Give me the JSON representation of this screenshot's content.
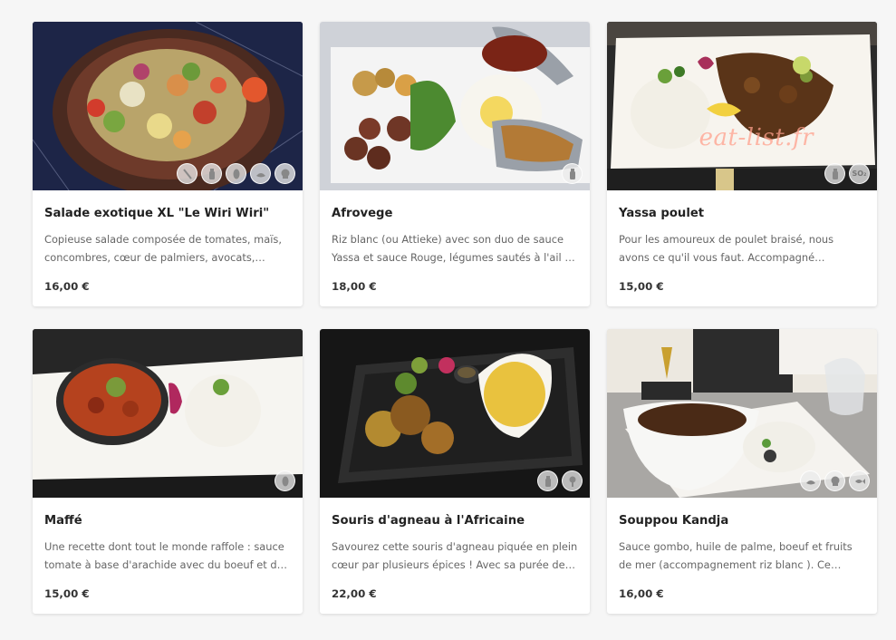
{
  "watermark": "eat-list.fr",
  "dishes": [
    {
      "title": "Salade exotique XL \"Le Wiri Wiri\"",
      "description": "Copieuse salade composée de tomates, maïs, concombres, cœur de palmiers, avocats, crevettes et oignons rouges.",
      "price": "16,00 €",
      "badge_icons": [
        "cutlery-icon",
        "bottle-icon",
        "peanut-icon",
        "shellfish-icon",
        "chef-hat-icon"
      ]
    },
    {
      "title": "Afrovege",
      "description": "Riz blanc (ou Attieke) avec son duo de sauce Yassa et sauce Rouge, légumes sautés à l'ail et bananes plantain.",
      "price": "18,00 €",
      "badge_icons": [
        "bottle-icon"
      ]
    },
    {
      "title": "Yassa poulet",
      "description": "Pour les amoureux de poulet braisé, nous avons ce qu'il vous faut. Accompagné d'oignons confits et de riz.",
      "price": "15,00 €",
      "badge_icons": [
        "bottle-icon",
        "so2-icon"
      ],
      "badge_text": "SO₂"
    },
    {
      "title": "Maffé",
      "description": "Une recette dont tout le monde raffole : sauce tomate à base d'arachide avec du boeuf et des légumes.",
      "price": "15,00 €",
      "badge_icons": [
        "peanut-icon"
      ]
    },
    {
      "title": "Souris d'agneau à l'Africaine",
      "description": "Savourez cette souris d'agneau piquée en plein cœur par plusieurs épices ! Avec sa purée de patates douces.",
      "price": "22,00 €",
      "badge_icons": [
        "bottle-icon",
        "celery-icon"
      ]
    },
    {
      "title": "Souppou Kandja",
      "description": "Sauce gombo, huile de palme, boeuf et fruits de mer (accompagnement riz blanc ). Ce délicieux plat vous ravira.",
      "price": "16,00 €",
      "badge_icons": [
        "shellfish-icon",
        "chef-hat-icon",
        "fish-icon"
      ]
    }
  ]
}
